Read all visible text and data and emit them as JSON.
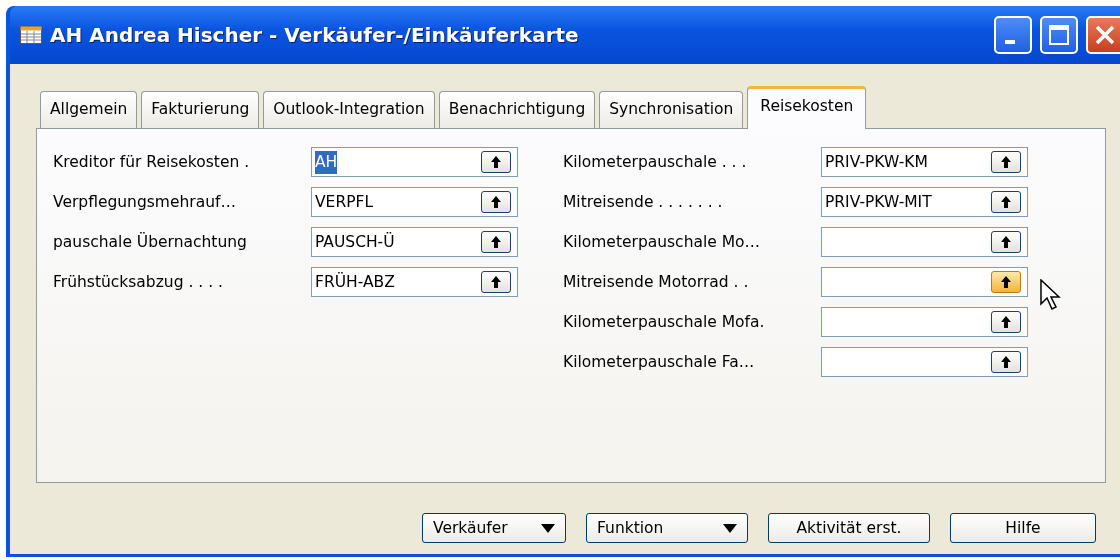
{
  "window": {
    "title": "AH Andrea Hischer - Verkäufer-/Einkäuferkarte"
  },
  "tabs": [
    {
      "label": "Allgemein",
      "selected": false
    },
    {
      "label": "Fakturierung",
      "selected": false
    },
    {
      "label": "Outlook-Integration",
      "selected": false
    },
    {
      "label": "Benachrichtigung",
      "selected": false
    },
    {
      "label": "Synchronisation",
      "selected": false
    },
    {
      "label": "Reisekosten",
      "selected": true
    }
  ],
  "left_fields": [
    {
      "label": "Kreditor für Reisekosten .",
      "value": "AH",
      "text_selected": true,
      "hovered": false
    },
    {
      "label": "Verpflegungsmehrauf…",
      "value": "VERPFL",
      "text_selected": false,
      "hovered": false
    },
    {
      "label": "pauschale Übernachtung",
      "value": "PAUSCH-Ü",
      "text_selected": false,
      "hovered": false
    },
    {
      "label": "Frühstücksabzug . . . .",
      "value": "FRÜH-ABZ",
      "text_selected": false,
      "hovered": false
    }
  ],
  "right_fields": [
    {
      "label": "Kilometerpauschale . . .",
      "value": "PRIV-PKW-KM",
      "text_selected": false,
      "hovered": false
    },
    {
      "label": "Mitreisende . . . . . . .",
      "value": "PRIV-PKW-MIT",
      "text_selected": false,
      "hovered": false
    },
    {
      "label": "Kilometerpauschale Mo…",
      "hovered": false
    },
    {
      "label": "Mitreisende Motorrad . .",
      "hovered": true
    },
    {
      "label": "Kilometerpauschale Mofa.",
      "hovered": false
    },
    {
      "label": "Kilometerpauschale Fa…",
      "hovered": false
    }
  ],
  "buttons": [
    {
      "label": "Verkäufer",
      "kind": "menu"
    },
    {
      "label": "Funktion",
      "kind": "menu"
    },
    {
      "label": "Aktivität erst.",
      "kind": "plain"
    },
    {
      "label": "Hilfe",
      "kind": "plain"
    }
  ]
}
